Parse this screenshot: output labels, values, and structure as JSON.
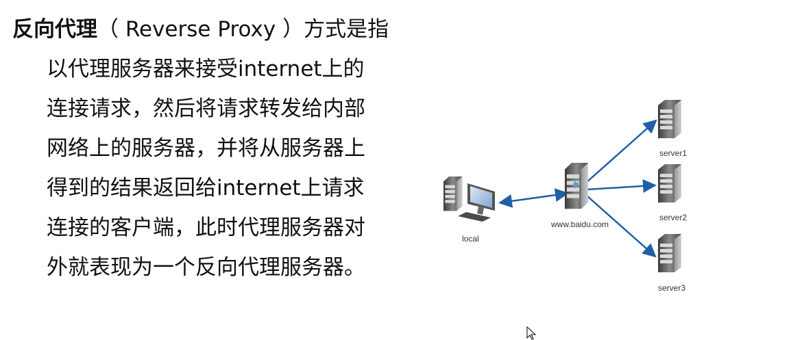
{
  "text": {
    "term": "反向代理",
    "paren_en": "（ Reverse  Proxy ）",
    "first_rest": "方式是指",
    "lines": [
      "以代理服务器来接受internet上的",
      "连接请求，然后将请求转发给内部",
      "网络上的服务器，并将从服务器上",
      "得到的结果返回给internet上请求",
      "连接的客户端，此时代理服务器对",
      "外就表现为一个反向代理服务器。"
    ]
  },
  "diagram": {
    "local_label": "local",
    "proxy_label": "www.baidu.com",
    "servers": [
      "server1",
      "server2",
      "server3"
    ],
    "arrow_color": "#1f5fa8",
    "icons": {
      "local": "desktop-computer-icon",
      "proxy": "server-tower-icon",
      "server": "server-tower-icon"
    }
  }
}
